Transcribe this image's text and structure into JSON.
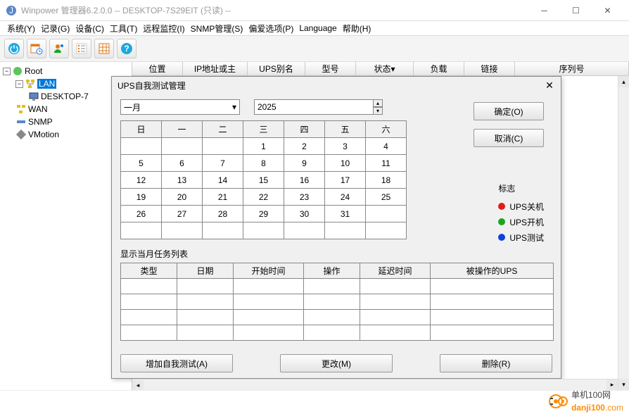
{
  "window": {
    "title": "Winpower 管理器6.2.0.0 -- DESKTOP-7S29EIT (只读) --"
  },
  "menu": [
    "系统(Y)",
    "记录(G)",
    "设备(C)",
    "工具(T)",
    "远程监控(I)",
    "SNMP管理(S)",
    "偏爱选项(P)",
    "Language",
    "帮助(H)"
  ],
  "tree": {
    "root": "Root",
    "lan": "LAN",
    "desktop": "DESKTOP-7",
    "wan": "WAN",
    "snmp": "SNMP",
    "vmotion": "VMotion"
  },
  "columns": [
    "位置",
    "IP地址或主",
    "UPS别名",
    "型号",
    "状态",
    "负载",
    "链接",
    "序列号"
  ],
  "dialog": {
    "title": "UPS自我测试管理",
    "month": "一月",
    "year": "2025",
    "ok": "确定(O)",
    "cancel": "取消(C)",
    "weekdays": [
      "日",
      "一",
      "二",
      "三",
      "四",
      "五",
      "六"
    ],
    "weeks": [
      [
        "",
        "",
        "",
        "1",
        "2",
        "3",
        "4"
      ],
      [
        "5",
        "6",
        "7",
        "8",
        "9",
        "10",
        "11"
      ],
      [
        "12",
        "13",
        "14",
        "15",
        "16",
        "17",
        "18"
      ],
      [
        "19",
        "20",
        "21",
        "22",
        "23",
        "24",
        "25"
      ],
      [
        "26",
        "27",
        "28",
        "29",
        "30",
        "31",
        ""
      ],
      [
        "",
        "",
        "",
        "",
        "",
        "",
        ""
      ]
    ],
    "legend": {
      "title": "标志",
      "off": "UPS关机",
      "on": "UPS开机",
      "test": "UPS测试"
    },
    "tasks_label": "显示当月任务列表",
    "task_cols": [
      "类型",
      "日期",
      "开始时间",
      "操作",
      "延迟时间",
      "被操作的UPS"
    ],
    "add": "增加自我测试(A)",
    "modify": "更改(M)",
    "delete": "删除(R)"
  },
  "footer": {
    "brand": "单机100网",
    "suffix": "danji100",
    "com": ".com"
  },
  "colors": {
    "off": "#e01b1b",
    "on": "#1aa51a",
    "test": "#1040d8"
  }
}
